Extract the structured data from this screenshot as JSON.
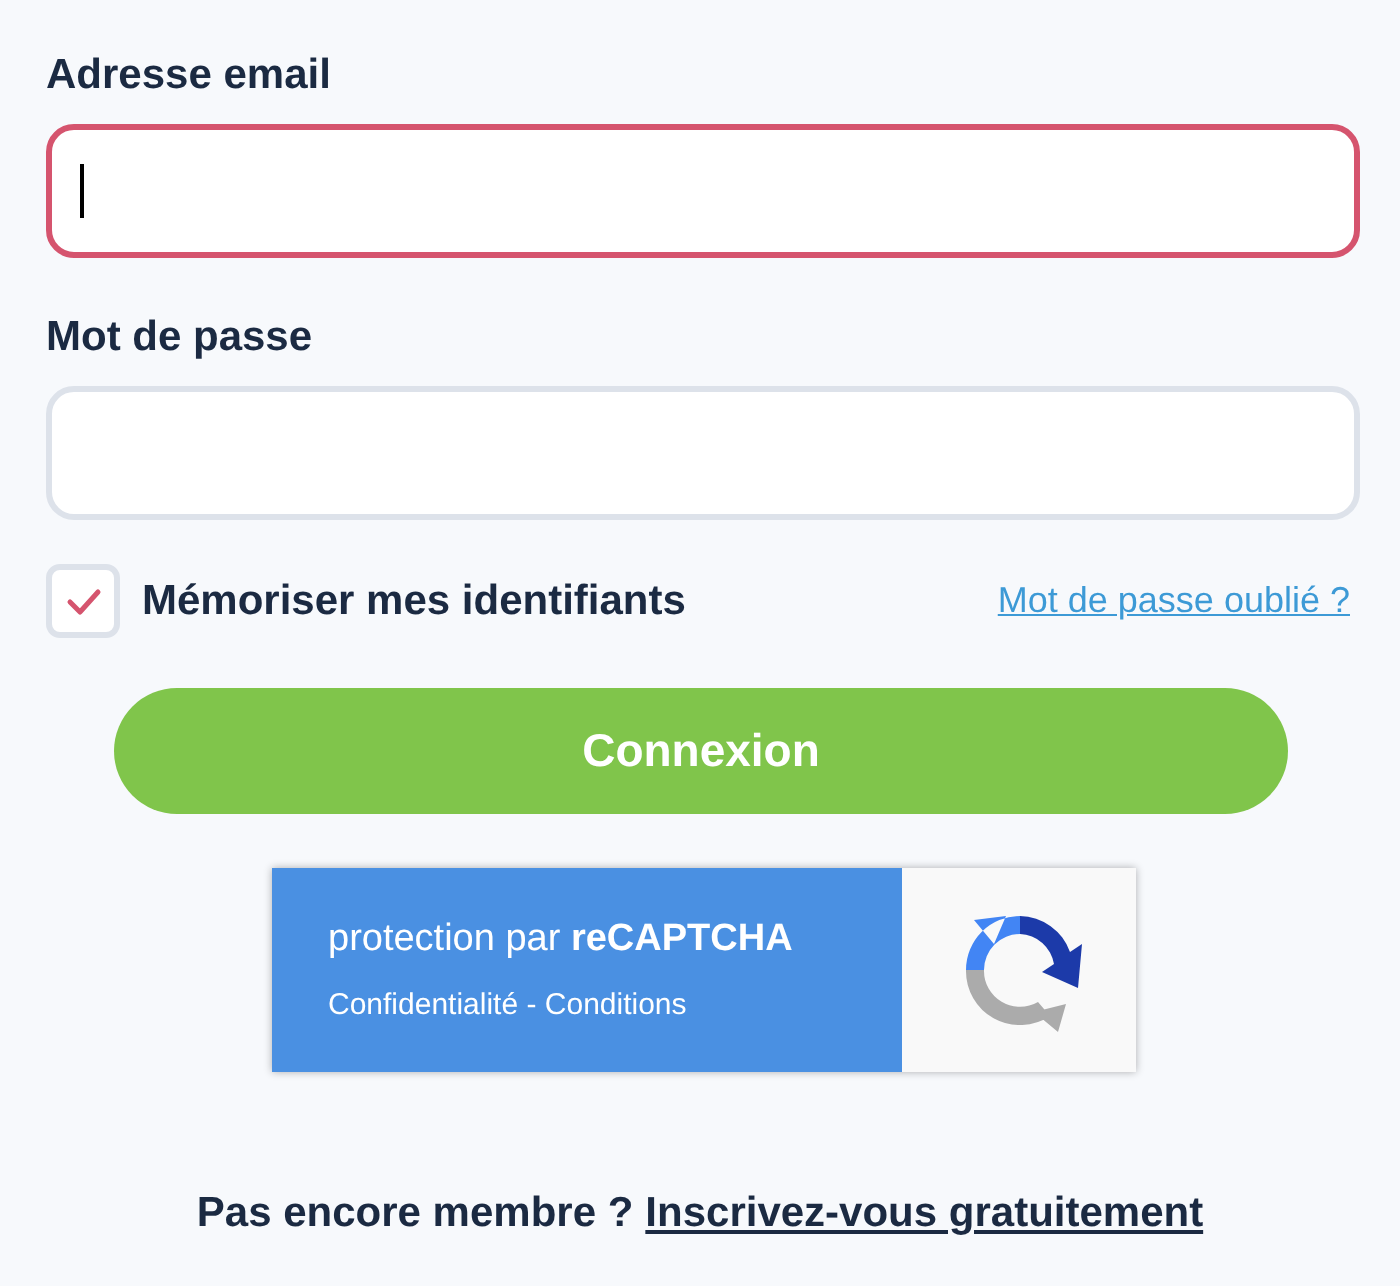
{
  "fields": [
    {
      "label": "Adresse email",
      "focused": true
    },
    {
      "label": "Mot de passe",
      "focused": false
    }
  ],
  "remember": {
    "label": "Mémoriser mes identifiants",
    "checked": true
  },
  "forgot_link": "Mot de passe oublié ?",
  "submit_button": "Connexion",
  "recaptcha": {
    "title": "protection par ",
    "brand": "reCAPTCHA",
    "links": "Confidentialité - Conditions"
  },
  "footer": {
    "text": "Pas encore membre ?",
    "link": "Inscrivez-vous gratuitement"
  }
}
